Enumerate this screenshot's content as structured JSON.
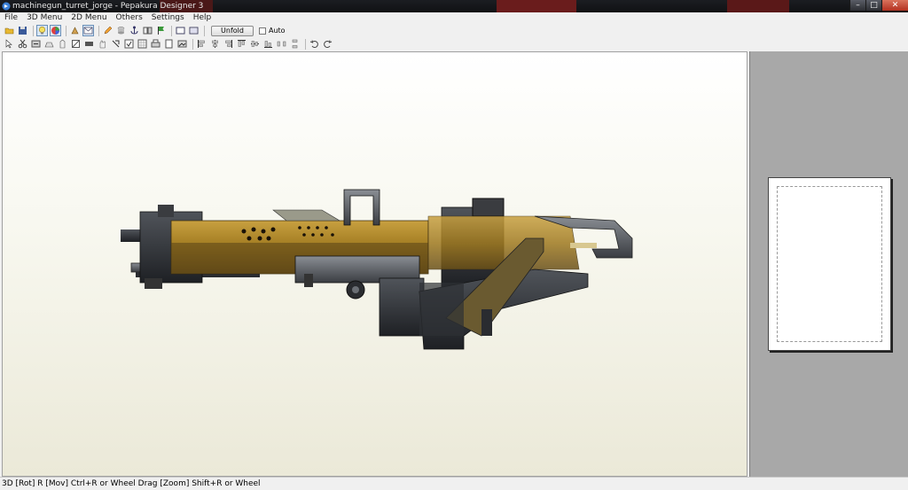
{
  "window": {
    "title": "machinegun_turret_jorge - Pepakura Designer 3",
    "buttons": {
      "minimize": "–",
      "maximize": "□",
      "close": "✕"
    }
  },
  "menu": {
    "items": [
      "File",
      "3D Menu",
      "2D Menu",
      "Others",
      "Settings",
      "Help"
    ]
  },
  "toolbar": {
    "unfold_label": "Unfold",
    "auto_label": "Auto",
    "auto_checked": false
  },
  "status": {
    "text": "3D [Rot] R [Mov] Ctrl+R or Wheel Drag [Zoom] Shift+R or Wheel"
  },
  "colors": {
    "accent_selected": "#d8e6f4",
    "viewport_bg": "#f8f8f0",
    "panel_bg": "#a8a8a8"
  }
}
